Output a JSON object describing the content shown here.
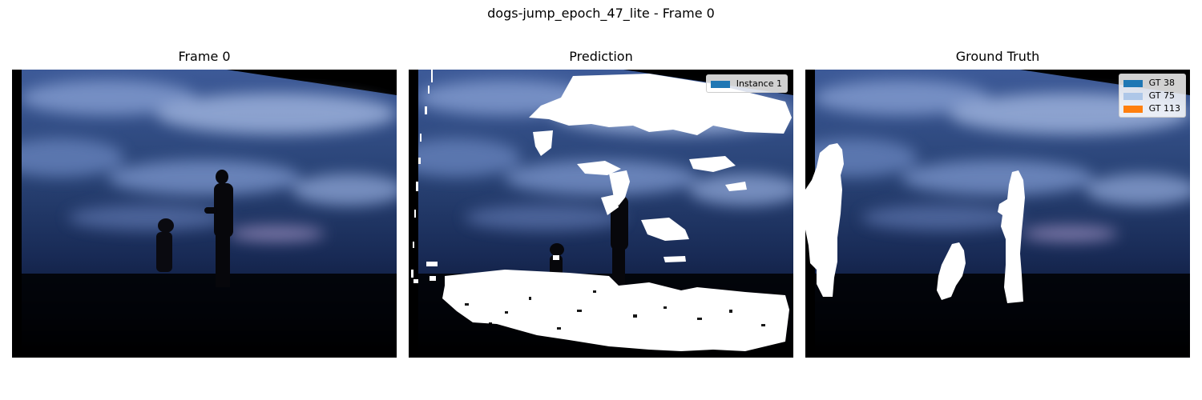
{
  "figure": {
    "suptitle": "dogs-jump_epoch_47_lite - Frame 0"
  },
  "panels": [
    {
      "title": "Frame 0"
    },
    {
      "title": "Prediction",
      "legend": [
        {
          "label": "Instance 1",
          "color": "#1f77b4"
        }
      ]
    },
    {
      "title": "Ground Truth",
      "legend": [
        {
          "label": "GT 38",
          "color": "#1f77b4"
        },
        {
          "label": "GT 75",
          "color": "#aec7e8"
        },
        {
          "label": "GT 113",
          "color": "#ff7f0e"
        }
      ]
    }
  ],
  "mask_color": "#ffffff",
  "sky_colors": {
    "deep": "#0b1634",
    "mid": "#2a4477",
    "light": "#b8c8e8"
  }
}
